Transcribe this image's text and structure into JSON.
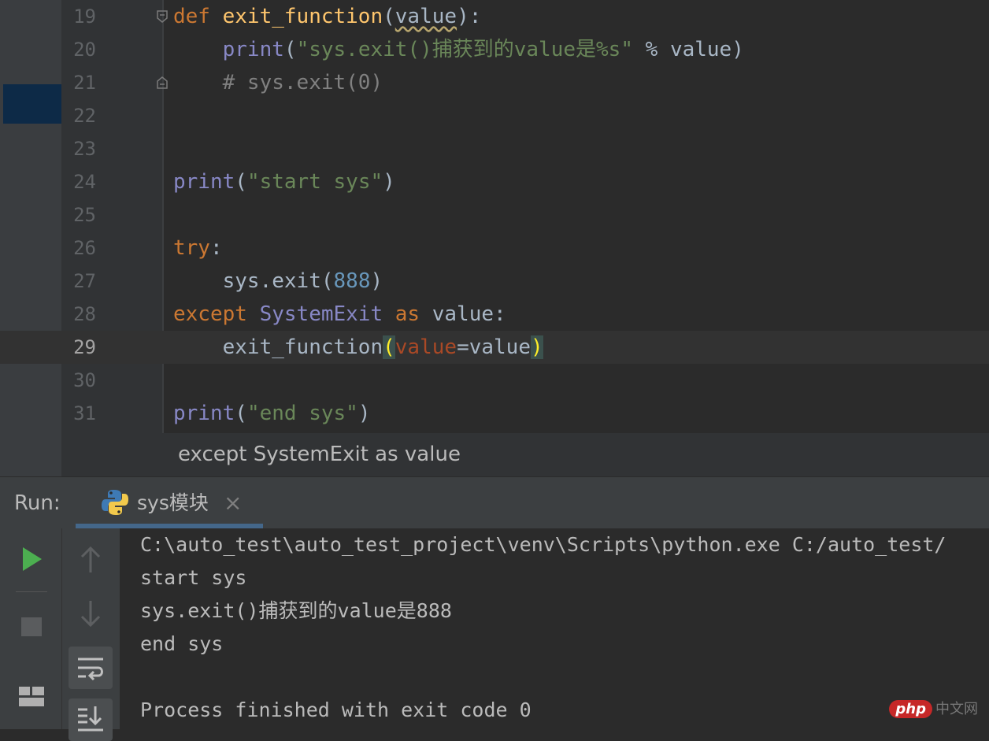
{
  "editor": {
    "lines": [
      {
        "n": "19"
      },
      {
        "n": "20"
      },
      {
        "n": "21"
      },
      {
        "n": "22"
      },
      {
        "n": "23"
      },
      {
        "n": "24"
      },
      {
        "n": "25"
      },
      {
        "n": "26"
      },
      {
        "n": "27"
      },
      {
        "n": "28"
      },
      {
        "n": "29"
      },
      {
        "n": "30"
      },
      {
        "n": "31"
      }
    ],
    "code": {
      "l19": {
        "kw": "def",
        "fn": "exit_function",
        "open": "(",
        "param": "value",
        "close": "):"
      },
      "l20": {
        "bi": "print",
        "open": "(",
        "str": "\"sys.exit()捕获到的value是%s\"",
        "rest": " % value)"
      },
      "l21": {
        "comment": "# sys.exit(0)"
      },
      "l24": {
        "bi": "print",
        "open": "(",
        "str": "\"start sys\"",
        "close": ")"
      },
      "l26": {
        "kw": "try",
        "colon": ":"
      },
      "l27": {
        "call": "sys.exit(",
        "num": "888",
        "close": ")"
      },
      "l28": {
        "kw1": "except",
        "cls": "SystemExit",
        "kw2": "as",
        "rest": "value:"
      },
      "l29": {
        "call": "exit_function",
        "open": "(",
        "pname": "value",
        "eq": "=value",
        "close": ")"
      },
      "l31": {
        "bi": "print",
        "open": "(",
        "str": "\"end sys\"",
        "close": ")"
      }
    },
    "current_line": "29",
    "breadcrumb": "except SystemExit as value"
  },
  "run": {
    "label": "Run:",
    "tab": {
      "label": "sys模块",
      "icon": "python-icon",
      "close": "×"
    },
    "toolbar1": [
      "run-icon",
      "stop-icon",
      "layout-icon"
    ],
    "toolbar2": [
      "up-arrow-icon",
      "down-arrow-icon",
      "soft-wrap-icon",
      "scroll-to-end-icon"
    ]
  },
  "console": {
    "lines": [
      "C:\\auto_test\\auto_test_project\\venv\\Scripts\\python.exe C:/auto_test/",
      "start sys",
      "sys.exit()捕获到的value是888",
      "end sys",
      "",
      "Process finished with exit code 0"
    ]
  },
  "watermark": {
    "badge": "php",
    "text": "中文网"
  },
  "colors": {
    "editor_bg": "#2b2b2b",
    "keyword": "#cc7832",
    "function": "#ffc66d",
    "builtin": "#8888c6",
    "string": "#6a8759",
    "number": "#6897bb",
    "comment": "#808080",
    "run_green": "#4caf50"
  }
}
